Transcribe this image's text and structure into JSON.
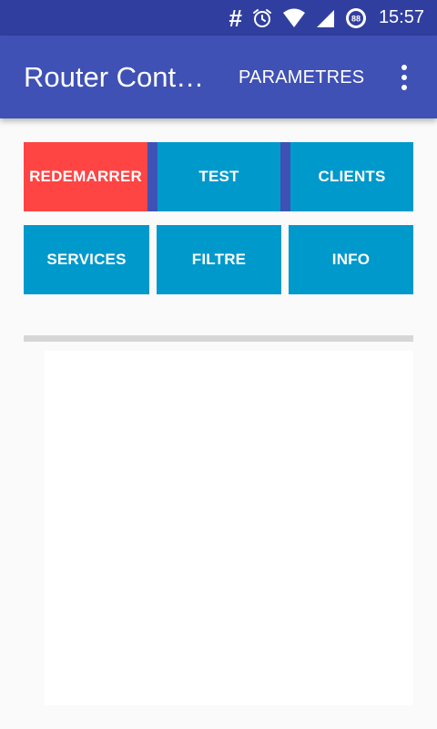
{
  "status_bar": {
    "time": "15:57",
    "battery_level": "88",
    "icons": [
      "hash-icon",
      "alarm-icon",
      "wifi-icon",
      "signal-icon",
      "battery-icon"
    ]
  },
  "app_bar": {
    "title": "Router Cont…",
    "action_label": "PARAMETRES",
    "overflow_icon": "more-vert-icon"
  },
  "buttons": {
    "row1": [
      "REDEMARRER",
      "TEST",
      "CLIENTS"
    ],
    "row2": [
      "SERVICES",
      "FILTRE",
      "INFO"
    ]
  },
  "colors": {
    "status_bar": "#303f9f",
    "app_bar": "#3f51b5",
    "button_blue": "#0099cc",
    "button_red": "#ff4444",
    "separator": "#3f51b5"
  }
}
